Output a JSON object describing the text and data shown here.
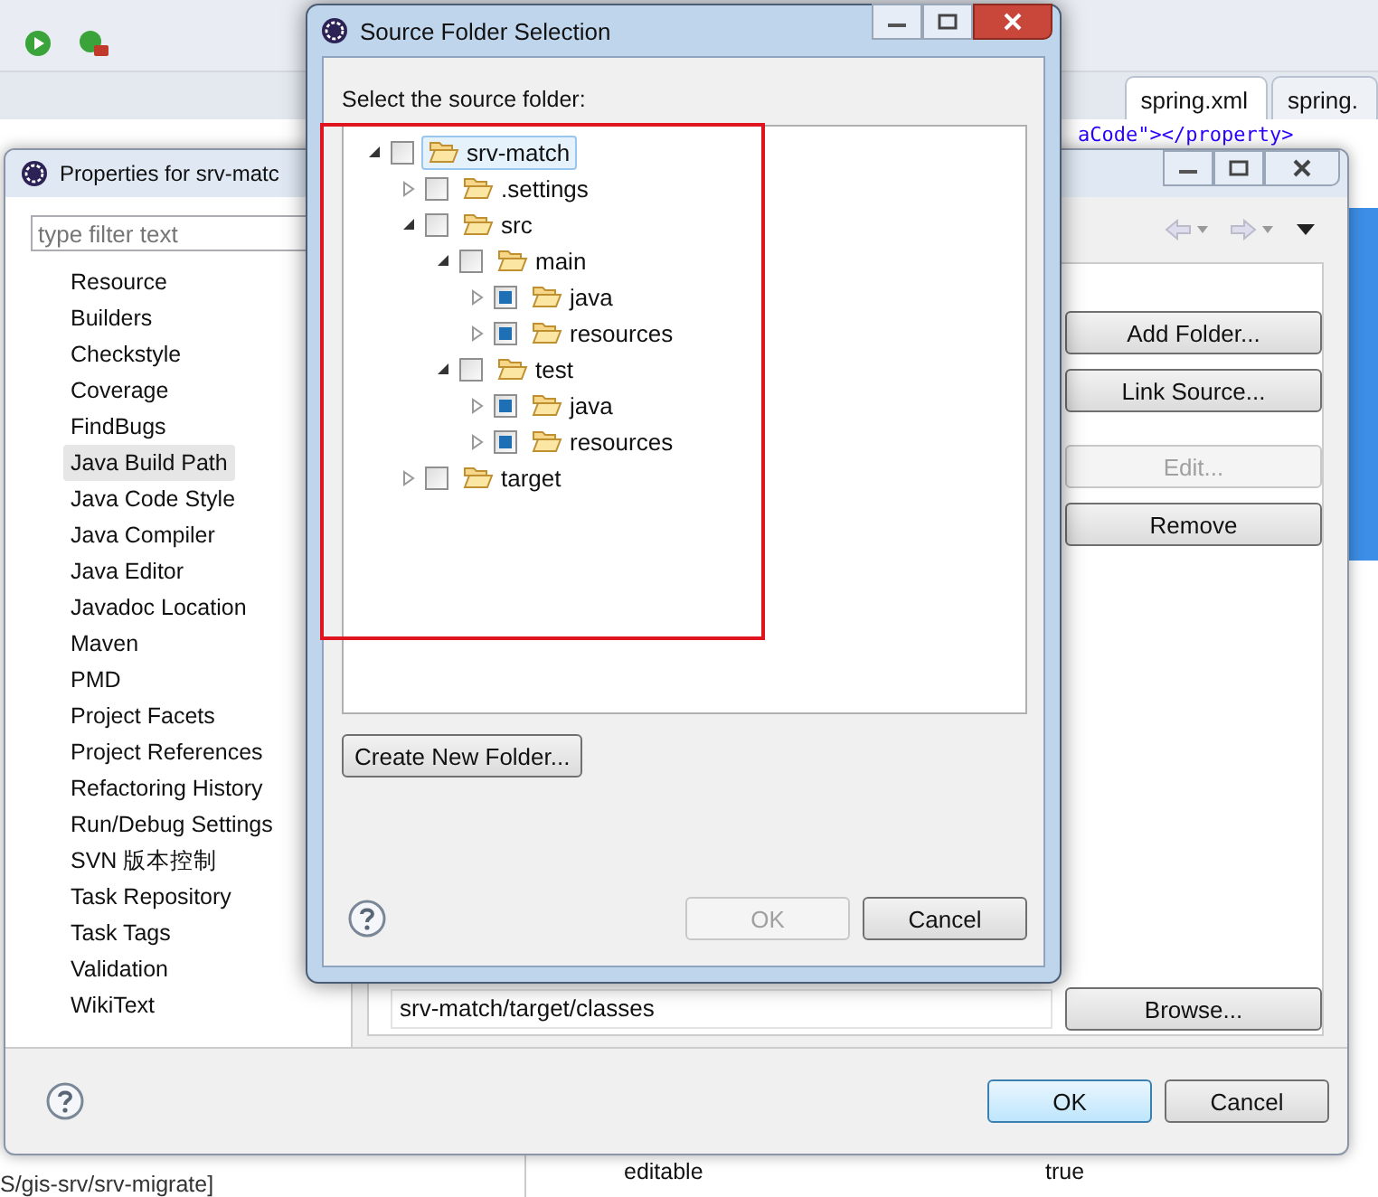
{
  "ide": {
    "editor_tabs": [
      {
        "label": "spring.xml",
        "selected": true
      },
      {
        "label": "spring.",
        "selected": false
      }
    ],
    "code_fragment": "aCode\"></property>",
    "bottom_cells": [
      "editable",
      "true"
    ],
    "status_path": "S/gis-srv/srv-migrate]"
  },
  "properties_dialog": {
    "title": "Properties for srv-matc",
    "filter": {
      "placeholder": "type filter text"
    },
    "pages": [
      {
        "label": "Resource",
        "selected": false
      },
      {
        "label": "Builders",
        "selected": false
      },
      {
        "label": "Checkstyle",
        "selected": false
      },
      {
        "label": "Coverage",
        "selected": false
      },
      {
        "label": "FindBugs",
        "selected": false
      },
      {
        "label": "Java Build Path",
        "selected": true
      },
      {
        "label": "Java Code Style",
        "selected": false
      },
      {
        "label": "Java Compiler",
        "selected": false
      },
      {
        "label": "Java Editor",
        "selected": false
      },
      {
        "label": "Javadoc Location",
        "selected": false
      },
      {
        "label": "Maven",
        "selected": false
      },
      {
        "label": "PMD",
        "selected": false
      },
      {
        "label": "Project Facets",
        "selected": false
      },
      {
        "label": "Project References",
        "selected": false
      },
      {
        "label": "Refactoring History",
        "selected": false
      },
      {
        "label": "Run/Debug Settings",
        "selected": false
      },
      {
        "label": "SVN 版本控制",
        "selected": false
      },
      {
        "label": "Task Repository",
        "selected": false
      },
      {
        "label": "Task Tags",
        "selected": false
      },
      {
        "label": "Validation",
        "selected": false
      },
      {
        "label": "WikiText",
        "selected": false
      }
    ],
    "side_buttons": [
      {
        "label": "Add Folder...",
        "disabled": false
      },
      {
        "label": "Link Source...",
        "disabled": false
      },
      {
        "label": "Edit...",
        "disabled": true
      },
      {
        "label": "Remove",
        "disabled": false
      }
    ],
    "output_folder": "srv-match/target/classes",
    "browse_button": "Browse...",
    "ok_button": "OK",
    "cancel_button": "Cancel"
  },
  "source_dialog": {
    "title": "Source Folder Selection",
    "prompt": "Select the source folder:",
    "tree": [
      {
        "label": "srv-match",
        "checked": false,
        "expanded": true,
        "selected": true,
        "children": [
          {
            "label": ".settings",
            "checked": false,
            "expanded": false,
            "selected": false
          },
          {
            "label": "src",
            "checked": false,
            "expanded": true,
            "selected": false,
            "children": [
              {
                "label": "main",
                "checked": false,
                "expanded": true,
                "selected": false,
                "children": [
                  {
                    "label": "java",
                    "checked": true,
                    "expanded": false,
                    "selected": false
                  },
                  {
                    "label": "resources",
                    "checked": true,
                    "expanded": false,
                    "selected": false
                  }
                ]
              },
              {
                "label": "test",
                "checked": false,
                "expanded": true,
                "selected": false,
                "children": [
                  {
                    "label": "java",
                    "checked": true,
                    "expanded": false,
                    "selected": false
                  },
                  {
                    "label": "resources",
                    "checked": true,
                    "expanded": false,
                    "selected": false
                  }
                ]
              }
            ]
          },
          {
            "label": "target",
            "checked": false,
            "expanded": false,
            "selected": false
          }
        ]
      }
    ],
    "create_button": "Create New Folder...",
    "ok_button": {
      "label": "OK",
      "disabled": true
    },
    "cancel_button": "Cancel"
  }
}
